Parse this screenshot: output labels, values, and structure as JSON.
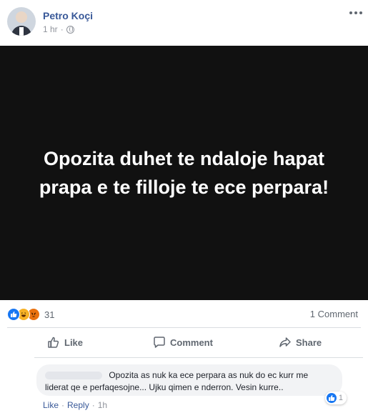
{
  "post": {
    "author": "Petro Koçi",
    "time": "1 hr",
    "separator": "·",
    "image_text": "Opozita duhet te ndaloje hapat prapa e te filloje te ece perpara!"
  },
  "reactions": {
    "count": "31",
    "types": [
      "like",
      "haha",
      "angry"
    ],
    "comments_label": "1 Comment"
  },
  "actions": {
    "like": "Like",
    "comment": "Comment",
    "share": "Share"
  },
  "comment": {
    "text": "Opozita as nuk ka ece perpara as nuk do ec kurr me liderat qe e perfaqesojne... Ujku qimen e nderron. Vesin kurre..",
    "reaction_count": "1",
    "like_label": "Like",
    "reply_label": "Reply",
    "dot": "·",
    "time": "1h"
  },
  "colors": {
    "link": "#385898",
    "like_blue": "#1877f2",
    "haha": "#f7b125",
    "angry": "#e9710f",
    "image_bg": "#111111"
  },
  "icons": [
    "globe-icon",
    "more-options-icon",
    "thumbs-up-icon",
    "comment-icon",
    "share-icon"
  ]
}
